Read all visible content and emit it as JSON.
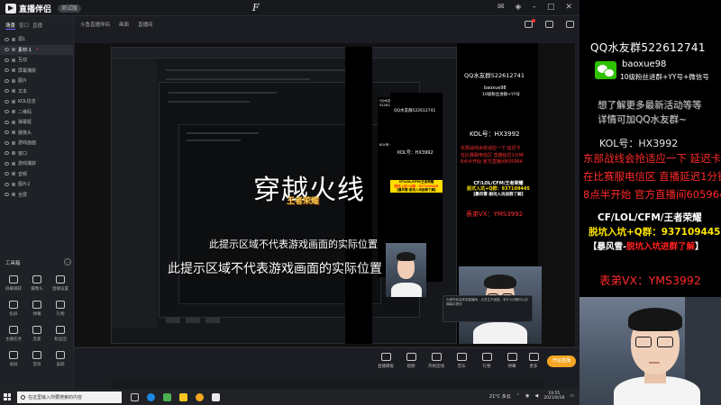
{
  "app": {
    "name": "直播伴侣",
    "badge": "测试版"
  },
  "sidebar": {
    "tabs": [
      "场景",
      "窗口",
      "直播"
    ],
    "scenes": [
      {
        "label": "源1",
        "active": false
      },
      {
        "label": "素材-1",
        "active": true,
        "red": "•"
      },
      {
        "label": "互动",
        "active": false
      },
      {
        "label": "屏幕捕获",
        "active": false
      },
      {
        "label": "图片",
        "active": false
      },
      {
        "label": "文本",
        "active": false
      },
      {
        "label": "KOL信息",
        "active": false
      },
      {
        "label": "二维码",
        "active": false
      },
      {
        "label": "弹幕姬",
        "active": false
      },
      {
        "label": "摄像头",
        "active": false
      },
      {
        "label": "游戏画面",
        "active": false
      },
      {
        "label": "窗口",
        "active": false
      },
      {
        "label": "游戏捕获",
        "active": false
      },
      {
        "label": "音频",
        "active": false
      },
      {
        "label": "图片2",
        "active": false
      },
      {
        "label": "全屏",
        "active": false
      }
    ],
    "tools_title": "工具箱",
    "tools_more": "…",
    "tools": [
      "屏幕捕获",
      "摄像头",
      "直播设置",
      "投屏",
      "弹幕",
      "礼物",
      "主播任务",
      "连麦",
      "粉丝团",
      "录屏",
      "音效",
      "美颜"
    ]
  },
  "topbar": {
    "items": [
      "斗鱼直播伴侣",
      "画面",
      "直播间"
    ]
  },
  "canvas": {
    "title": "穿越火线",
    "subtitle": "王者荣耀",
    "notice_small": "此提示区域不代表游戏画面的实际位置",
    "notice_big": "此提示区域不代表游戏画面的实际位置"
  },
  "mini_overlay": {
    "qq": "QQ水友群522612741",
    "wx": "baoxue98",
    "wx2": "10级粉丝进群+YY号",
    "kol": "KOL号：HX3992",
    "card1": "CF/LOL/CFM/王者荣耀",
    "card2": "脱坑入坑+Q群：937109445",
    "card3": "【暴风雪-脱坑入坑进群了解】",
    "brother": "表弟VX：YMS3992"
  },
  "chat_popup": "大家好欢迎来到直播间，点关注不迷路，有什么问题可以在弹幕中提问",
  "bottombar": {
    "buttons": [
      "直播模板",
      "视频",
      "开始连线",
      "音乐",
      "礼物",
      "弹幕",
      "更多"
    ],
    "start_label": "开始直播"
  },
  "taskbar": {
    "search_placeholder": "在这里输入你要搜索的内容",
    "weather": "21°C 多云",
    "time": "19:55",
    "date": "2021/6/18"
  },
  "overlay": {
    "qq_group": "QQ水友群522612741",
    "wx_id": "baoxue98",
    "wx_note": "10级粉丝进群+YY号+微信号",
    "promo1": "想了解更多最新活动等等",
    "promo2": "详情可加QQ水友群~",
    "kol": "KOL号：HX3992",
    "red_lines": [
      "东部战线会抢适应一下 延迟卡",
      "在比赛服电信区  直播延迟1分钟",
      "8点半开始 官方直播间605964"
    ],
    "card_games": "CF/LOL/CFM/王者荣耀",
    "card_qq": "脱坑入坑+Q群：937109445",
    "card_tag_prefix": "【暴风雪-",
    "card_tag_red": "脱坑入坑进群了解",
    "card_tag_suffix": "】",
    "brother_vx": "表弟VX：YMS3992"
  },
  "colors": {
    "accent": "#f5a623",
    "red_text": "#ff2a2a",
    "yellow_text": "#ffe600",
    "wechat_green": "#2dc100"
  }
}
